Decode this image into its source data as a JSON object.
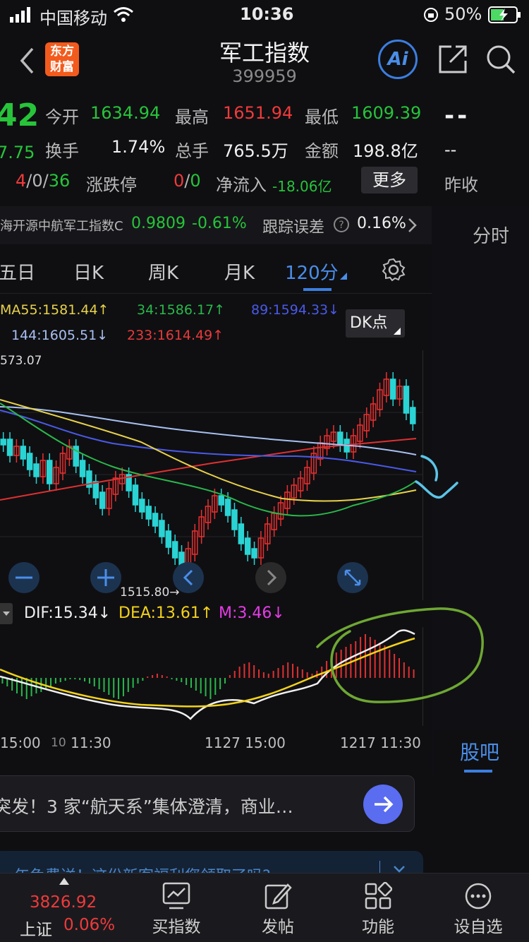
{
  "status_bar": {
    "carrier": "中国移动",
    "time": "10:36",
    "battery": "50%"
  },
  "header": {
    "title": "军工指数",
    "code": "399959",
    "logo_top": "东方",
    "logo_bottom": "财富",
    "ai_label": "Ai"
  },
  "quote": {
    "price_partial": "42",
    "change_partial": "7.75",
    "today_open_label": "今开",
    "today_open": "1634.94",
    "high_label": "最高",
    "high": "1651.94",
    "low_label": "最低",
    "low": "1609.39",
    "turnover_label": "换手",
    "turnover": "1.74%",
    "volume_label": "总手",
    "volume": "765.5万",
    "amount_label": "金额",
    "amount": "198.8亿",
    "updown_red": "4",
    "updown_sep1": "/",
    "updown_flat": "0",
    "updown_sep2": "/",
    "updown_green": "36",
    "limit_label": "涨跌停",
    "limit_red": "0",
    "limit_sep": "/",
    "limit_green": "0",
    "netflow_label": "净流入",
    "netflow": "-18.06亿",
    "more_button": "更多",
    "right_dash1": "--",
    "right_dash2": "--",
    "prev_close_label": "昨收"
  },
  "fund_bar": {
    "fund_name": "海开源中航军工指数C",
    "fund_price": "0.9809",
    "fund_change": "-0.61%",
    "tracking_label": "跟踪误差",
    "tracking_value": "0.16%"
  },
  "right_panel": {
    "tab_timeshare": "分时",
    "tab_guba": "股吧"
  },
  "period_tabs": [
    "五日",
    "日K",
    "周K",
    "月K",
    "120分"
  ],
  "ma_legend": {
    "ma55": "MA55:1581.44↑",
    "ma34": "34:1586.17↑",
    "ma89": "89:1594.33↓",
    "ma144": "144:1605.51↓",
    "ma233": "233:1614.49↑",
    "dk_button": "DK点"
  },
  "chart_labels": {
    "top_price": "573.07",
    "low_price": "1515.80→"
  },
  "macd_legend": {
    "dif": "DIF:15.34↓",
    "dea": "DEA:13.61↑",
    "m": "M:3.46↓"
  },
  "time_axis": {
    "t1": "15:00",
    "t2": "10",
    "t3": "11:30",
    "t4": "1127 15:00",
    "t5": "1217 11:30"
  },
  "news": {
    "text": "突发！3 家“航天系”集体澄清，商业…"
  },
  "promo": {
    "text": "年兔费送！这份新客福利您领取了吗?"
  },
  "bottom_nav": {
    "index_value": "3826.92",
    "index_name": "上证",
    "index_change": "0.06%",
    "buy_index": "买指数",
    "post": "发帖",
    "functions": "功能",
    "settings": "设自选"
  },
  "colors": {
    "up": "#f03a3a",
    "down": "#27c43a",
    "accent": "#4a8ee8",
    "annotation_green": "#6ea733",
    "annotation_cyan": "#5cc4e8"
  }
}
